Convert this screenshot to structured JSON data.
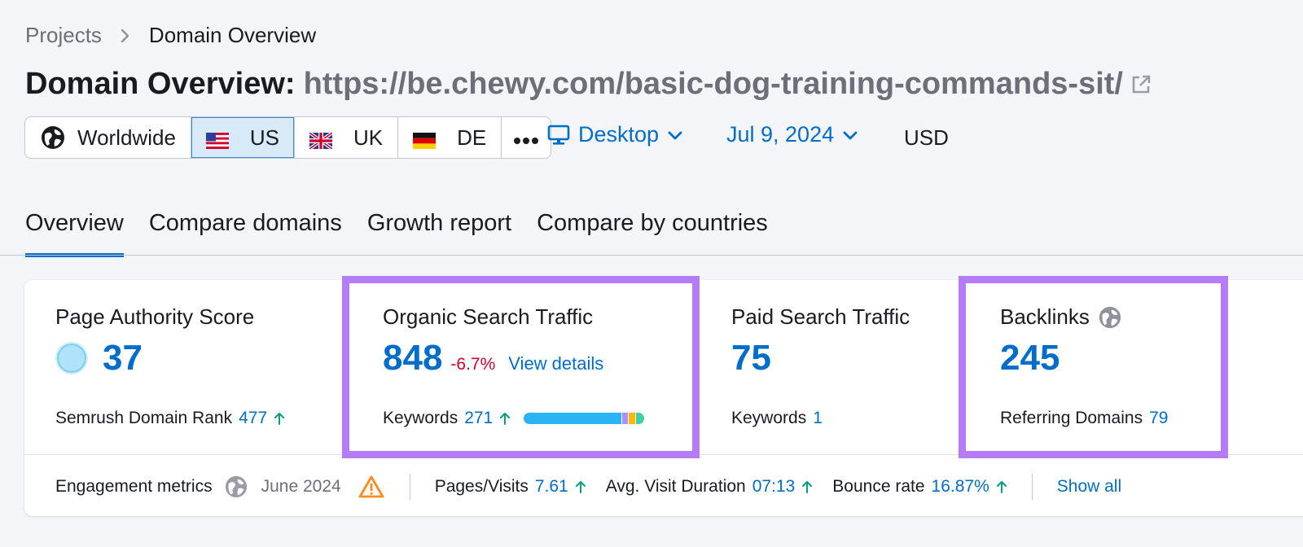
{
  "breadcrumb": {
    "parent": "Projects",
    "current": "Domain Overview"
  },
  "title": {
    "label": "Domain Overview:",
    "url": "https://be.chewy.com/basic-dog-training-commands-sit/"
  },
  "databases": [
    {
      "label": "Worldwide",
      "icon": "globe-icon"
    },
    {
      "label": "US",
      "icon": "us-flag-icon",
      "active": true
    },
    {
      "label": "UK",
      "icon": "uk-flag-icon"
    },
    {
      "label": "DE",
      "icon": "de-flag-icon"
    },
    {
      "label": "•••",
      "icon": "more-icon"
    }
  ],
  "device": {
    "label": "Desktop",
    "icon": "desktop-icon"
  },
  "date": {
    "label": "Jul 9, 2024"
  },
  "currency": "USD",
  "tabs": [
    "Overview",
    "Compare domains",
    "Growth report",
    "Compare by countries"
  ],
  "metrics": {
    "authority": {
      "title": "Page Authority Score",
      "value": "37",
      "sub_label": "Semrush Domain Rank",
      "sub_value": "477"
    },
    "organic": {
      "title": "Organic Search Traffic",
      "value": "848",
      "change": "-6.7%",
      "link": "View details",
      "sub_label": "Keywords",
      "sub_value": "271"
    },
    "paid": {
      "title": "Paid Search Traffic",
      "value": "75",
      "sub_label": "Keywords",
      "sub_value": "1"
    },
    "backlinks": {
      "title": "Backlinks",
      "value": "245",
      "sub_label": "Referring Domains",
      "sub_value": "79"
    }
  },
  "engagement": {
    "label": "Engagement metrics",
    "date": "June 2024",
    "pages_visits_label": "Pages/Visits",
    "pages_visits_value": "7.61",
    "duration_label": "Avg. Visit Duration",
    "duration_value": "07:13",
    "bounce_label": "Bounce rate",
    "bounce_value": "16.87%",
    "show_all": "Show all"
  },
  "colors": {
    "accent": "#006dca",
    "negative": "#d1002f",
    "positive": "#009f81",
    "highlight": "#b47cf6",
    "keyword_bar": [
      "#2ab4f5",
      "#b18cff",
      "#ffb800",
      "#3ed1a2"
    ]
  }
}
